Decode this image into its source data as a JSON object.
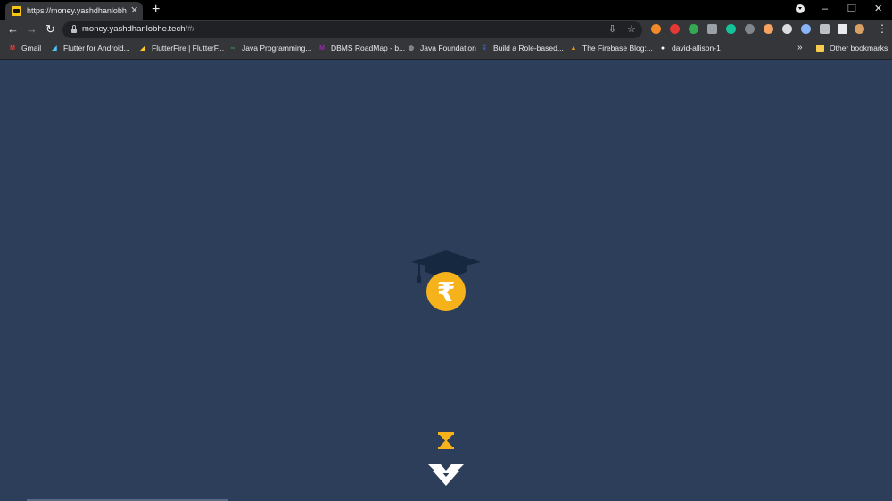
{
  "browser": {
    "tab": {
      "title": "https://money.yashdhanlobhe.tech"
    },
    "new_tab_glyph": "+",
    "window_controls": {
      "minimize": "–",
      "restore": "❐",
      "close": "✕"
    },
    "address": {
      "host": "money.yashdhanlobhe.tech",
      "path": "/#/"
    },
    "nav": {
      "back": "←",
      "forward": "→",
      "reload": "↻"
    },
    "extensions": [
      {
        "name": "ext-lightning-icon",
        "color": "#f28b27"
      },
      {
        "name": "ext-red-icon",
        "color": "#e53935"
      },
      {
        "name": "ext-green-plus-icon",
        "color": "#34a853"
      },
      {
        "name": "ext-pocket-icon",
        "color": "#9aa0a6"
      },
      {
        "name": "ext-grammarly-icon",
        "color": "#15c39a"
      },
      {
        "name": "ext-gray-circle-icon",
        "color": "#80868b"
      },
      {
        "name": "ext-honey-icon",
        "color": "#f4a261"
      },
      {
        "name": "ext-white-circle-icon",
        "color": "#dadce0"
      },
      {
        "name": "ext-blue-circle-icon",
        "color": "#8ab4f8"
      },
      {
        "name": "ext-gray-square-icon",
        "color": "#bdc1c6"
      },
      {
        "name": "extensions-puzzle-icon",
        "color": "#e8eaed"
      },
      {
        "name": "profile-avatar-icon",
        "color": "#d9a066"
      }
    ]
  },
  "bookmarks": {
    "items": [
      {
        "label": "Gmail",
        "icon": "gmail-icon",
        "color": "#ea4335",
        "glyph": "M"
      },
      {
        "label": "Flutter for Android...",
        "icon": "flutter-icon",
        "color": "#4fc3f7",
        "glyph": "◢"
      },
      {
        "label": "FlutterFire | FlutterF...",
        "icon": "flutterfire-icon",
        "color": "#ffca28",
        "glyph": "◢"
      },
      {
        "label": "Java Programming...",
        "icon": "geeks-icon",
        "color": "#2f8d46",
        "glyph": "∞"
      },
      {
        "label": "DBMS RoadMap - b...",
        "icon": "roadmap-icon",
        "color": "#9c27b0",
        "glyph": "M"
      },
      {
        "label": "Java Foundation",
        "icon": "globe-icon",
        "color": "#9aa0a6",
        "glyph": "◍"
      },
      {
        "label": "Build a Role-based...",
        "icon": "bookmark-blue-icon",
        "color": "#3367d6",
        "glyph": "⁑"
      },
      {
        "label": "The Firebase Blog:...",
        "icon": "firebase-icon",
        "color": "#ffa000",
        "glyph": "▲"
      },
      {
        "label": "david-allison-1",
        "icon": "github-icon",
        "color": "#ffffff",
        "glyph": "●"
      }
    ],
    "more_glyph": "»",
    "other": "Other bookmarks"
  },
  "app": {
    "logo": {
      "currency_symbol": "₹",
      "cap_color": "#16283f",
      "coin_color": "#f5b21a"
    },
    "loader_color": "#f5b21a",
    "emblem_color": "#ffffff"
  }
}
